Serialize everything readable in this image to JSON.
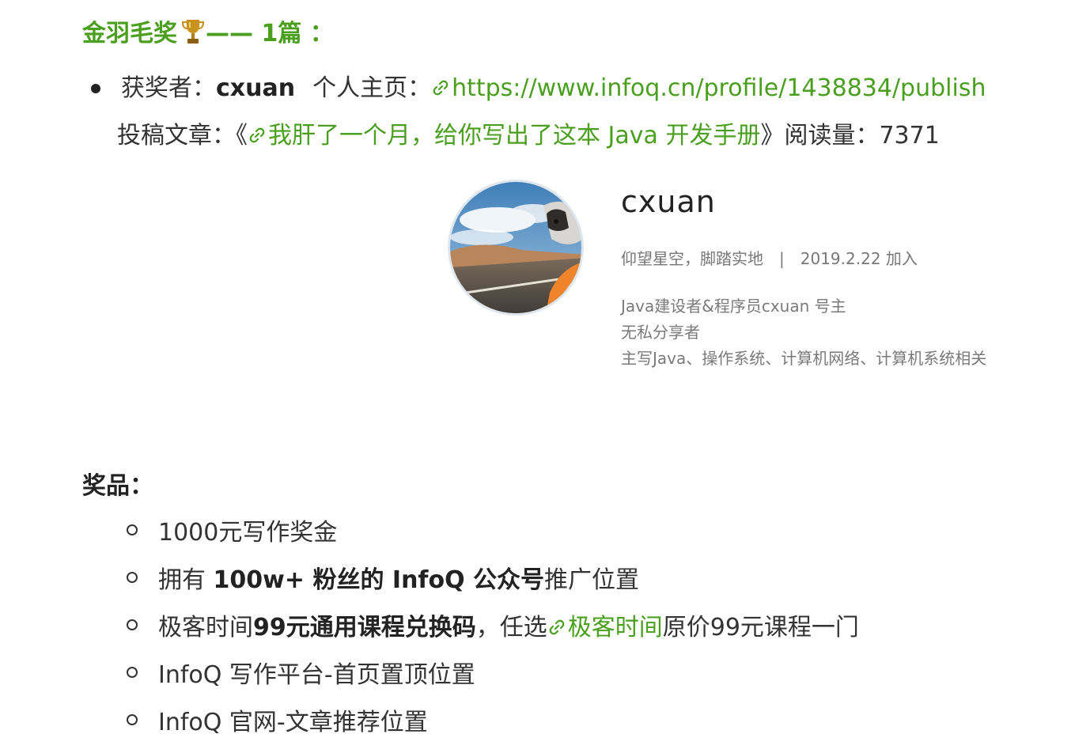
{
  "award": {
    "title": "金羽毛奖",
    "icon": "trophy-icon",
    "dash_count": "—— 1篇 ："
  },
  "winner": {
    "label": "获奖者：",
    "name": "cxuan",
    "homepage_label": "个人主页：",
    "homepage_url": "https://www.infoq.cn/profile/1438834/publish",
    "article_label": "投稿文章：",
    "article_open": "《",
    "article_title": "我肝了一个月，给你写出了这本 Java 开发手册",
    "article_close": "》",
    "reads_label": "阅读量：",
    "reads": "7371"
  },
  "profile": {
    "name": "cxuan",
    "motto": "仰望星空，脚踏实地",
    "separator": "|",
    "joined": "2019.2.22 加入",
    "bio": [
      "Java建设者&程序员cxuan 号主",
      "无私分享者",
      "主写Java、操作系统、计算机网络、计算机系统相关"
    ]
  },
  "prizes": {
    "title": "奖品：",
    "item1": "1000元写作奖金",
    "item2_pre": "拥有 ",
    "item2_bold": "100w+ 粉丝的 InfoQ 公众号",
    "item2_post": "推广位置",
    "item3_pre": "极客时间",
    "item3_bold": "99元通用课程兑换码",
    "item3_mid": "，任选",
    "item3_link": "极客时间",
    "item3_post": "原价99元课程一门",
    "item4": "InfoQ 写作平台-首页置顶位置",
    "item5": "InfoQ 官网-文章推荐位置"
  },
  "colors": {
    "accent": "#4a9f1f",
    "text": "#333333"
  }
}
